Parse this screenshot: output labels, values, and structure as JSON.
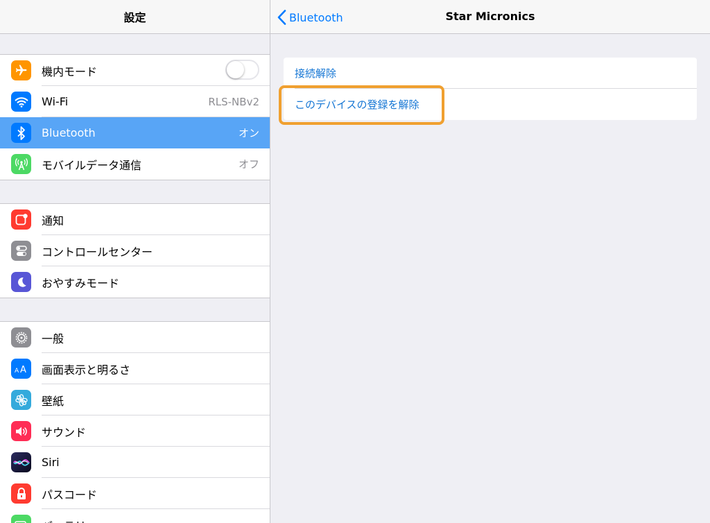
{
  "sidebar": {
    "title": "設定",
    "groups": [
      [
        {
          "name": "airplane",
          "label": "機内モード",
          "icon": "airplane-icon",
          "color": "#ff9500",
          "control": "toggle",
          "toggle_on": false
        },
        {
          "name": "wifi",
          "label": "Wi-Fi",
          "icon": "wifi-icon",
          "color": "#007aff",
          "value": "RLS-NBv2"
        },
        {
          "name": "bluetooth",
          "label": "Bluetooth",
          "icon": "bluetooth-icon",
          "color": "#007aff",
          "value": "オン",
          "selected": true
        },
        {
          "name": "cellular",
          "label": "モバイルデータ通信",
          "icon": "cellular-icon",
          "color": "#4cd964",
          "value": "オフ"
        }
      ],
      [
        {
          "name": "notifications",
          "label": "通知",
          "icon": "notifications-icon",
          "color": "#ff3b30"
        },
        {
          "name": "control-center",
          "label": "コントロールセンター",
          "icon": "control-center-icon",
          "color": "#8e8e93"
        },
        {
          "name": "do-not-disturb",
          "label": "おやすみモード",
          "icon": "moon-icon",
          "color": "#5856d6"
        }
      ],
      [
        {
          "name": "general",
          "label": "一般",
          "icon": "gear-icon",
          "color": "#8e8e93"
        },
        {
          "name": "display",
          "label": "画面表示と明るさ",
          "icon": "display-icon",
          "color": "#007aff"
        },
        {
          "name": "wallpaper",
          "label": "壁紙",
          "icon": "wallpaper-icon",
          "color": "#34aadc"
        },
        {
          "name": "sounds",
          "label": "サウンド",
          "icon": "speaker-icon",
          "color": "#ff2d55"
        },
        {
          "name": "siri",
          "label": "Siri",
          "icon": "siri-icon",
          "color": "#1c1c3c"
        },
        {
          "name": "passcode",
          "label": "パスコード",
          "icon": "lock-icon",
          "color": "#ff3b30"
        },
        {
          "name": "battery",
          "label": "バッテリー",
          "icon": "battery-icon",
          "color": "#4cd964"
        }
      ]
    ]
  },
  "detail": {
    "back_label": "Bluetooth",
    "title": "Star Micronics",
    "actions": [
      {
        "name": "disconnect",
        "label": "接続解除"
      },
      {
        "name": "forget-device",
        "label": "このデバイスの登録を解除",
        "highlighted": true
      }
    ],
    "highlight_color": "#f0a030"
  }
}
